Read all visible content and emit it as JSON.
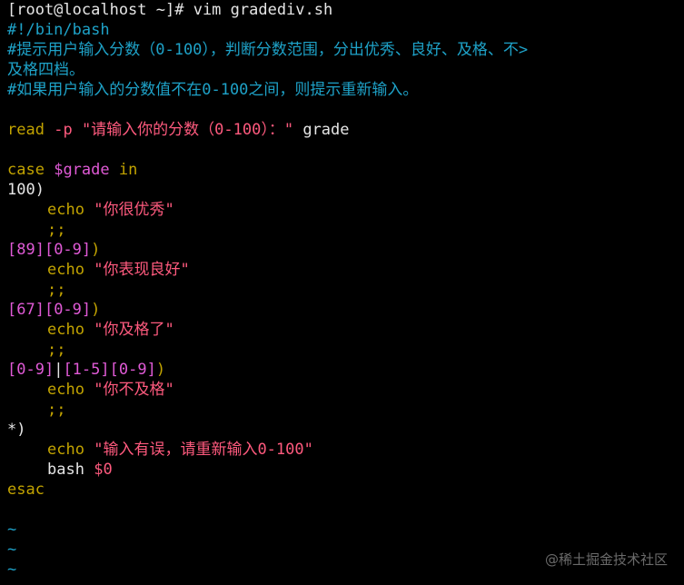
{
  "terminal": {
    "prompt_user_host": "[root@localhost ~]#",
    "command": " vim gradediv.sh"
  },
  "file": {
    "shebang": "#!/bin/bash",
    "comment1a": "#提示用户输入分数（0-100），判断分数范围，分出优秀、良好、及格、不>",
    "comment1b": "及格四档。",
    "comment2": "#如果用户输入的分数值不在0-100之间，则提示重新输入。",
    "read_kw": "read",
    "read_opt": "-p",
    "read_str": "\"请输入你的分数（0-100）：\"",
    "read_var": " grade",
    "case_kw": "case",
    "case_var": "$grade",
    "case_in": "in",
    "pat1": "100",
    "paren": ")",
    "echo_kw": "echo",
    "str1": "\"你很优秀\"",
    "dsemi": ";;",
    "pat2a": "[89]",
    "pat2b": "[0-9]",
    "str2": "\"你表现良好\"",
    "pat3a": "[67]",
    "pat3b": "[0-9]",
    "str3": "\"你及格了\"",
    "pat4a": "[0-9]",
    "pat4bar": "|",
    "pat4b": "[1-5]",
    "pat4c": "[0-9]",
    "str4": "\"你不及格\"",
    "pat5": "*",
    "str5": "\"输入有误，请重新输入0-100\"",
    "bash_kw": "bash",
    "bash_var": "$0",
    "esac_kw": "esac",
    "tilde": "~"
  },
  "watermark": "@稀土掘金技术社区"
}
